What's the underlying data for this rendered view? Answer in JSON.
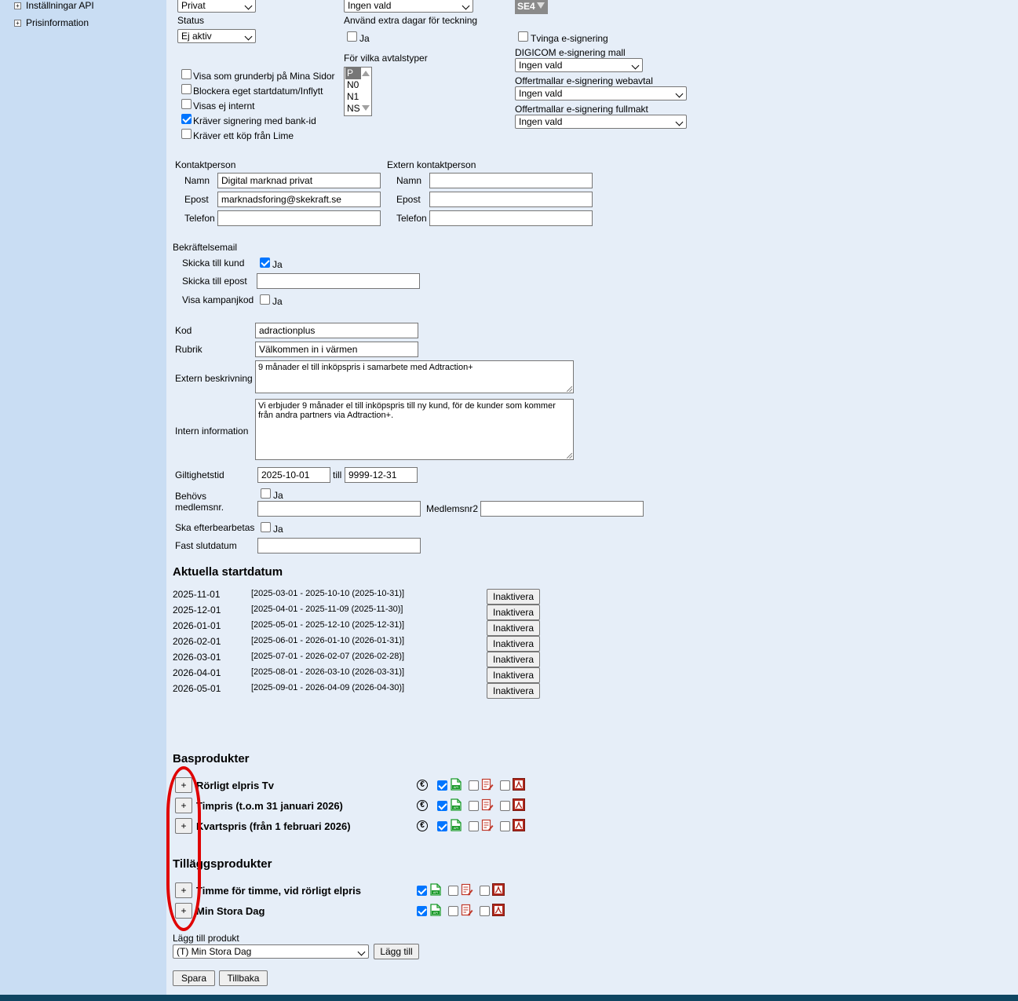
{
  "sidebar": {
    "items": [
      {
        "label": "Inställningar API",
        "toggle": "+"
      },
      {
        "label": "Prisinformation",
        "toggle": "+"
      }
    ]
  },
  "top": {
    "type_select": "Privat",
    "status_label": "Status",
    "status_select": "Ej aktiv",
    "extra_select": "Ingen vald",
    "extra_days_label": "Använd extra dagar för teckning",
    "extra_days_ja": "Ja",
    "se_select": "SE4",
    "force_esign": "Tvinga e-signering",
    "digicom_label": "DIGICOM e-signering mall",
    "digicom_select": "Ingen vald",
    "webavtal_label": "Offertmallar e-signering webavtal",
    "webavtal_select": "Ingen vald",
    "fullmakt_label": "Offertmallar e-signering fullmakt",
    "fullmakt_select": "Ingen vald",
    "avtalstyper_label": "För vilka avtalstyper",
    "avtalstyper": [
      "P",
      "N0",
      "N1",
      "NS"
    ]
  },
  "checkboxes": [
    {
      "label": "Visa som grunderbj på Mina Sidor",
      "checked": false
    },
    {
      "label": "Blockera eget startdatum/Inflytt",
      "checked": false
    },
    {
      "label": "Visas ej internt",
      "checked": false
    },
    {
      "label": "Kräver signering med bank-id",
      "checked": true
    },
    {
      "label": "Kräver ett köp från Lime",
      "checked": false
    }
  ],
  "contact": {
    "title": "Kontaktperson",
    "name_label": "Namn",
    "name": "Digital marknad privat",
    "email_label": "Epost",
    "email": "marknadsforing@skekraft.se",
    "phone_label": "Telefon",
    "phone": ""
  },
  "ext_contact": {
    "title": "Extern kontaktperson",
    "name_label": "Namn",
    "name": "",
    "email_label": "Epost",
    "email": "",
    "phone_label": "Telefon",
    "phone": ""
  },
  "confirm": {
    "title": "Bekräftelsemail",
    "send_customer_label": "Skicka till kund",
    "send_customer_ja": "Ja",
    "send_email_label": "Skicka till epost",
    "send_email": "",
    "show_campaign_label": "Visa kampanjkod",
    "show_campaign_ja": "Ja"
  },
  "offer": {
    "kod_label": "Kod",
    "kod": "adractionplus",
    "rubrik_label": "Rubrik",
    "rubrik": "Välkommen in i värmen",
    "ext_desc_label": "Extern beskrivning",
    "ext_desc": "9 månader el till inköpspris i samarbete med Adtraction+",
    "int_info_label": "Intern information",
    "int_info": "Vi erbjuder 9 månader el till inköpspris till ny kund, för de kunder som kommer från andra partners via Adtraction+.",
    "validity_label": "Giltighetstid",
    "valid_from": "2025-10-01",
    "valid_to_label": "till",
    "valid_to": "9999-12-31",
    "member_label": "Behövs medlemsnr.",
    "member_ja": "Ja",
    "member_value": "",
    "member2_label": "Medlemsnr2",
    "member2_value": "",
    "post_label": "Ska efterbearbetas",
    "post_ja": "Ja",
    "fixed_end_label": "Fast slutdatum",
    "fixed_end": ""
  },
  "startdates": {
    "title": "Aktuella startdatum",
    "button_label": "Inaktivera",
    "rows": [
      {
        "date": "2025-11-01",
        "range": "[2025-03-01 - 2025-10-10 (2025-10-31)]"
      },
      {
        "date": "2025-12-01",
        "range": "[2025-04-01 - 2025-11-09 (2025-11-30)]"
      },
      {
        "date": "2026-01-01",
        "range": "[2025-05-01 - 2025-12-10 (2025-12-31)]"
      },
      {
        "date": "2026-02-01",
        "range": "[2025-06-01 - 2026-01-10 (2026-01-31)]"
      },
      {
        "date": "2026-03-01",
        "range": "[2025-07-01 - 2026-02-07 (2026-02-28)]"
      },
      {
        "date": "2026-04-01",
        "range": "[2025-08-01 - 2026-03-10 (2026-03-31)]"
      },
      {
        "date": "2026-05-01",
        "range": "[2025-09-01 - 2026-04-09 (2026-04-30)]"
      }
    ]
  },
  "basprodukter": {
    "title": "Basprodukter",
    "items": [
      {
        "name": "Rörligt elpris Tv",
        "api": true,
        "edit": false,
        "pdf": false
      },
      {
        "name": "Timpris (t.o.m 31 januari 2026)",
        "api": true,
        "edit": false,
        "pdf": false
      },
      {
        "name": "Kvartspris (från 1 februari 2026)",
        "api": true,
        "edit": false,
        "pdf": false
      }
    ]
  },
  "tillagg": {
    "title": "Tilläggsprodukter",
    "items": [
      {
        "name": "Timme för timme, vid rörligt elpris",
        "api": true,
        "edit": false,
        "pdf": false
      },
      {
        "name": "Min Stora Dag",
        "api": true,
        "edit": false,
        "pdf": false
      }
    ]
  },
  "add_product": {
    "label": "Lägg till produkt",
    "select": "(T) Min Stora Dag",
    "button": "Lägg till"
  },
  "actions": {
    "save": "Spara",
    "back": "Tillbaka"
  },
  "plus_label": "+",
  "euro_symbol": "€",
  "colors": {
    "sidebar": "#c9ddf3",
    "main": "#e6eef8",
    "footer": "#0e4561",
    "highlight": "#e00000",
    "check": "#0075ff"
  }
}
